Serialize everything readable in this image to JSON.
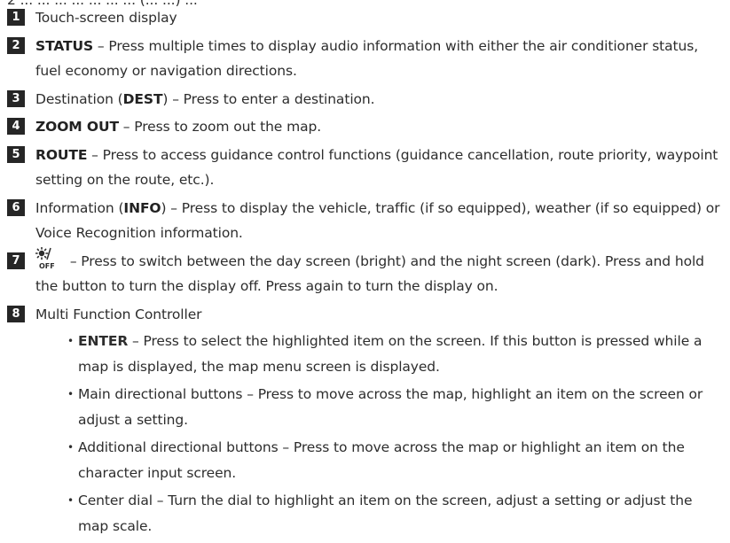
{
  "cut_off_line": "2 ... ... ... ... ... ... ... (... ...) ...",
  "items": [
    {
      "num": "1",
      "parts": [
        {
          "t": "Touch-screen display",
          "b": false
        }
      ]
    },
    {
      "num": "2",
      "parts": [
        {
          "t": "STATUS",
          "b": true
        },
        {
          "t": " – Press multiple times to display audio information with either the air conditioner status, fuel economy or navigation directions.",
          "b": false
        }
      ]
    },
    {
      "num": "3",
      "parts": [
        {
          "t": "Destination (",
          "b": false
        },
        {
          "t": "DEST",
          "b": true
        },
        {
          "t": ") – Press to enter a destination.",
          "b": false
        }
      ]
    },
    {
      "num": "4",
      "parts": [
        {
          "t": "ZOOM OUT",
          "b": true
        },
        {
          "t": " – Press to zoom out the map.",
          "b": false
        }
      ]
    },
    {
      "num": "5",
      "parts": [
        {
          "t": "ROUTE",
          "b": true
        },
        {
          "t": " – Press to access guidance control functions (guidance cancellation, route priority, waypoint setting on the route, etc.).",
          "b": false
        }
      ]
    },
    {
      "num": "6",
      "parts": [
        {
          "t": "Information (",
          "b": false
        },
        {
          "t": "INFO",
          "b": true
        },
        {
          "t": ") – Press to display the vehicle, traffic (if so equipped), weather (if so equipped) or Voice Recognition information.",
          "b": false
        }
      ]
    },
    {
      "num": "7",
      "icon": "day-night-icon",
      "icon_sub": "OFF",
      "parts": [
        {
          "t": " – Press to switch between the day screen (bright) and the night screen (dark). Press and hold the button to turn the display off. Press again to turn the display on.",
          "b": false
        }
      ]
    },
    {
      "num": "8",
      "parts": [
        {
          "t": "Multi Function Controller",
          "b": false
        }
      ],
      "subitems": [
        [
          {
            "t": "ENTER",
            "b": true
          },
          {
            "t": " – Press to select the highlighted item on the screen. If this button is pressed while a map is displayed, the map menu screen is displayed.",
            "b": false
          }
        ],
        [
          {
            "t": "Main directional buttons – Press to move across the map, highlight an item on the screen or adjust a setting.",
            "b": false
          }
        ],
        [
          {
            "t": "Additional directional buttons – Press to move across the map or highlight an item on the character input screen.",
            "b": false
          }
        ],
        [
          {
            "t": "Center dial – Turn the dial to highlight an item on the screen, adjust a setting or adjust the map scale.",
            "b": false
          }
        ]
      ]
    }
  ]
}
